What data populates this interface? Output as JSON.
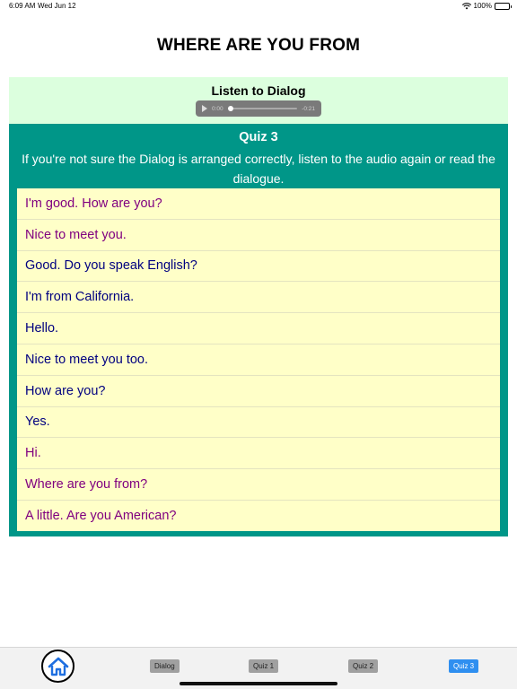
{
  "status_bar": {
    "time": "6:09 AM",
    "date": "Wed Jun 12",
    "battery": "100%"
  },
  "page_title": "WHERE ARE YOU FROM",
  "listen": {
    "title": "Listen to Dialog",
    "audio": {
      "current_time": "0:00",
      "remaining_time": "-0:21",
      "progress": 0.0
    }
  },
  "quiz": {
    "title": "Quiz 3",
    "instructions": "If you're not sure the Dialog is arranged correctly, listen to the audio again or read the dialogue.",
    "items": [
      {
        "text": "I'm good. How are you?",
        "color": "purple"
      },
      {
        "text": "Nice to meet you.",
        "color": "purple"
      },
      {
        "text": "Good. Do you speak English?",
        "color": "navy"
      },
      {
        "text": "I'm from California.",
        "color": "navy"
      },
      {
        "text": "Hello.",
        "color": "navy"
      },
      {
        "text": "Nice to meet you too.",
        "color": "navy"
      },
      {
        "text": "How are you?",
        "color": "navy"
      },
      {
        "text": "Yes.",
        "color": "navy"
      },
      {
        "text": "Hi.",
        "color": "purple"
      },
      {
        "text": "Where are you from?",
        "color": "purple"
      },
      {
        "text": "A little. Are you American?",
        "color": "purple"
      }
    ]
  },
  "tabs": {
    "home_icon": "home-icon",
    "dialog": "Dialog",
    "quiz1": "Quiz 1",
    "quiz2": "Quiz 2",
    "quiz3": "Quiz 3",
    "active": "quiz3"
  },
  "colors": {
    "listen_bg": "#dcffde",
    "quiz_bg": "#009688",
    "list_bg": "#ffffc8",
    "purple_text": "#800080",
    "navy_text": "#000080",
    "active_tab": "#2f8ff0"
  }
}
